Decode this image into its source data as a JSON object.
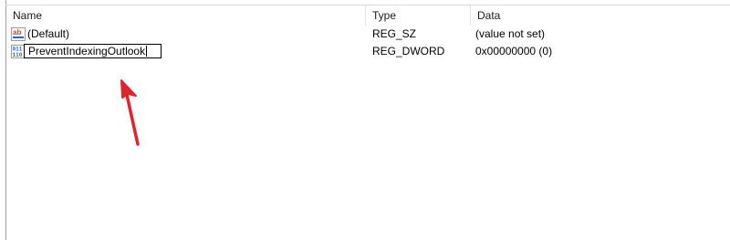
{
  "columns": {
    "name": "Name",
    "type": "Type",
    "data": "Data"
  },
  "rows": [
    {
      "icon": "string-value-icon",
      "name": "(Default)",
      "type": "REG_SZ",
      "data": "(value not set)"
    },
    {
      "icon": "binary-value-icon",
      "name": "PreventIndexingOutlook",
      "type": "REG_DWORD",
      "data": "0x00000000 (0)",
      "editing": true
    }
  ],
  "annotation": {
    "icon": "red-arrow-pointer",
    "color": "#e0242b"
  },
  "colors": {
    "string_icon_red": "#d43a2f",
    "binary_icon_blue": "#2a63c9"
  }
}
